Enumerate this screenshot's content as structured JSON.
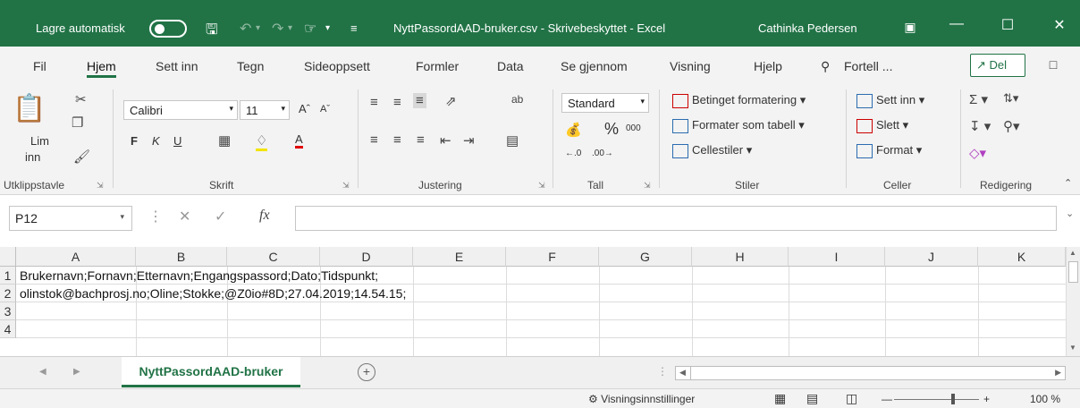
{
  "titlebar": {
    "autosave_label": "Lagre automatisk",
    "toggle_state": "Av",
    "doc_title": "NyttPassordAAD-bruker.csv  -  Skrivebeskyttet  -  Excel",
    "user": "Cathinka Pedersen",
    "bg_color": "#217346"
  },
  "tabs": [
    "Fil",
    "Hjem",
    "Sett inn",
    "Tegn",
    "Sideoppsett",
    "Formler",
    "Data",
    "Se gjennom",
    "Visning",
    "Hjelp"
  ],
  "active_tab": "Hjem",
  "search_placeholder": "Fortell ...",
  "share_label": "Del",
  "ribbon": {
    "clipboard": {
      "paste_label": "Lim",
      "paste_label2": "inn",
      "group": "Utklippstavle"
    },
    "font": {
      "name": "Calibri",
      "size": "11",
      "bold": "F",
      "italic": "K",
      "underline": "U",
      "group": "Skrift"
    },
    "alignment": {
      "group": "Justering"
    },
    "number": {
      "format": "Standard",
      "percent": "%",
      "thousands": "000",
      "group": "Tall"
    },
    "styles": {
      "conditional": "Betinget formatering",
      "as_table": "Formater som tabell",
      "cell_styles": "Cellestiler",
      "group": "Stiler"
    },
    "cells": {
      "insert": "Sett inn",
      "delete": "Slett",
      "format": "Format",
      "group": "Celler"
    },
    "editing": {
      "group": "Redigering"
    }
  },
  "formula_bar": {
    "name_box": "P12",
    "fx": "fx",
    "content": ""
  },
  "grid": {
    "columns": [
      "A",
      "B",
      "C",
      "D",
      "E",
      "F",
      "G",
      "H",
      "I",
      "J",
      "K"
    ],
    "rows": [
      {
        "num": "1",
        "A": "Brukernavn;Fornavn;Etternavn;Engangspassord;Dato;Tidspunkt;"
      },
      {
        "num": "2",
        "A": "olinstok@bachprosj.no;Oline;Stokke;@Z0io#8D;27.04.2019;14.54.15;"
      },
      {
        "num": "3",
        "A": ""
      },
      {
        "num": "4",
        "A": ""
      }
    ]
  },
  "sheet_tab": "NyttPassordAAD-bruker",
  "status": {
    "display_settings": "Visningsinnstillinger",
    "zoom": "100 %"
  }
}
